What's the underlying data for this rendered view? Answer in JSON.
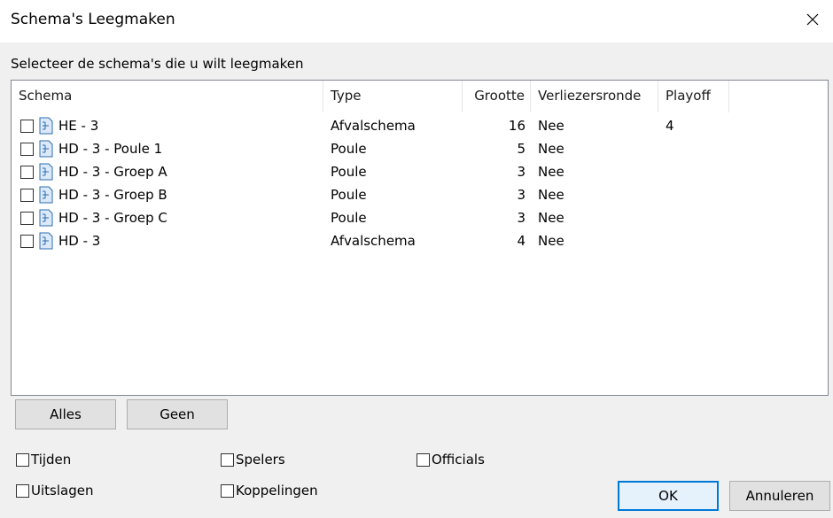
{
  "window": {
    "title": "Schema's Leegmaken"
  },
  "instruction": "Selecteer de schema's die u wilt leegmaken",
  "columns": {
    "schema": "Schema",
    "type": "Type",
    "grootte": "Grootte",
    "verliezersronde": "Verliezersronde",
    "playoff": "Playoff"
  },
  "rows": [
    {
      "name": "HE - 3",
      "type": "Afvalschema",
      "size": "16",
      "loser": "Nee",
      "playoff": "4"
    },
    {
      "name": "HD - 3 - Poule 1",
      "type": "Poule",
      "size": "5",
      "loser": "Nee",
      "playoff": ""
    },
    {
      "name": "HD - 3 - Groep A",
      "type": "Poule",
      "size": "3",
      "loser": "Nee",
      "playoff": ""
    },
    {
      "name": "HD - 3 - Groep B",
      "type": "Poule",
      "size": "3",
      "loser": "Nee",
      "playoff": ""
    },
    {
      "name": "HD - 3 - Groep C",
      "type": "Poule",
      "size": "3",
      "loser": "Nee",
      "playoff": ""
    },
    {
      "name": "HD - 3",
      "type": "Afvalschema",
      "size": "4",
      "loser": "Nee",
      "playoff": ""
    }
  ],
  "buttons": {
    "all": "Alles",
    "none": "Geen",
    "ok": "OK",
    "cancel": "Annuleren"
  },
  "options": {
    "tijden": "Tijden",
    "spelers": "Spelers",
    "officials": "Officials",
    "uitslagen": "Uitslagen",
    "koppelingen": "Koppelingen"
  },
  "colors": {
    "accent": "#0078d7",
    "dialog_bg": "#f0f0f0",
    "icon": "#2b6cb0"
  },
  "icons": {
    "close": "close-icon",
    "row": "schema-document-icon"
  }
}
